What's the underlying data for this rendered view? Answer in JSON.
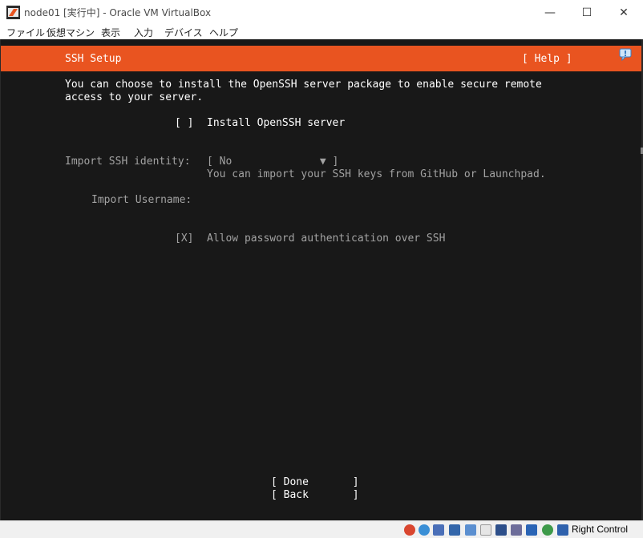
{
  "window": {
    "title": "node01 [実行中] - Oracle VM VirtualBox",
    "minimize_glyph": "—",
    "maximize_glyph": "☐",
    "close_glyph": "✕"
  },
  "menu": [
    "ファイル",
    "仮想マシン",
    "表示",
    "入力",
    "デバイス",
    "ヘルプ"
  ],
  "screen": {
    "header_title": "SSH Setup",
    "help_button": "[ Help ]",
    "intro_line1": "You can choose to install the OpenSSH server package to enable secure remote",
    "intro_line2": "access to your server.",
    "install_checkbox": "[ ]",
    "install_label": "Install OpenSSH server",
    "import_identity_label": "Import SSH identity:",
    "import_identity_select": "[ No              ▼ ]",
    "import_identity_hint": "You can import your SSH keys from GitHub or Launchpad.",
    "import_username_label": "Import Username:",
    "allow_password_checkbox": "[X]",
    "allow_password_label": "Allow password authentication over SSH",
    "done_button": "[ Done       ]",
    "back_button": "[ Back       ]"
  },
  "statusbar": {
    "host_key": "Right Control"
  },
  "colors": {
    "accent": "#e95420",
    "console_bg": "#181818"
  }
}
